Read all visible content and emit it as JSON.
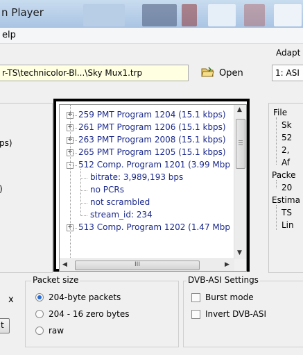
{
  "window": {
    "title": "n Player"
  },
  "menu": {
    "help": "elp"
  },
  "toolbar": {
    "file_path": "r-TS\\technicolor-Bl...\\Sky Mux1.trp",
    "open_label": "Open",
    "adapter_label": "Adapt",
    "adapter_value": "1: ASI"
  },
  "left_panel": {
    "fragments": [
      "ps)",
      ")"
    ]
  },
  "tree": {
    "rows": [
      {
        "expander": "+",
        "text": "259 PMT Program 1204  (15.1 kbps)"
      },
      {
        "expander": "+",
        "text": "261 PMT Program 1206  (15.1 kbps)"
      },
      {
        "expander": "+",
        "text": "263 PMT Program 2008  (15.1 kbps)"
      },
      {
        "expander": "+",
        "text": "265 PMT Program 1205  (15.1 kbps)"
      },
      {
        "expander": "-",
        "text": "512 Comp. Program 1201  (3.99 Mbp"
      },
      {
        "expander": "",
        "text": "bitrate: 3,989,193 bps"
      },
      {
        "expander": "",
        "text": "no PCRs"
      },
      {
        "expander": "",
        "text": "not scrambled"
      },
      {
        "expander": "",
        "text": "stream_id: 234"
      },
      {
        "expander": "+",
        "text": "513 Comp. Program 1202  (1.47 Mbp"
      }
    ],
    "hscroll_thumb": "III"
  },
  "right_tree": {
    "items": [
      "File",
      "Sk",
      "52",
      "2,",
      "Af",
      "Packe",
      "20",
      "Estima",
      "TS",
      "Lin"
    ]
  },
  "packet_size": {
    "legend": "Packet size",
    "options": [
      {
        "label": "204-byte packets",
        "selected": true
      },
      {
        "label": "204 - 16 zero bytes",
        "selected": false
      },
      {
        "label": "raw",
        "selected": false
      }
    ]
  },
  "dvb_asi": {
    "legend": "DVB-ASI Settings",
    "options": [
      {
        "label": "Burst mode",
        "checked": false
      },
      {
        "label": "Invert DVB-ASI",
        "checked": false
      }
    ]
  },
  "left_bottom": {
    "fragment": "x",
    "button_fragment": "t"
  },
  "colors": {
    "tree_text": "#1b2a8c",
    "selection_accent": "#2a6bd0"
  }
}
